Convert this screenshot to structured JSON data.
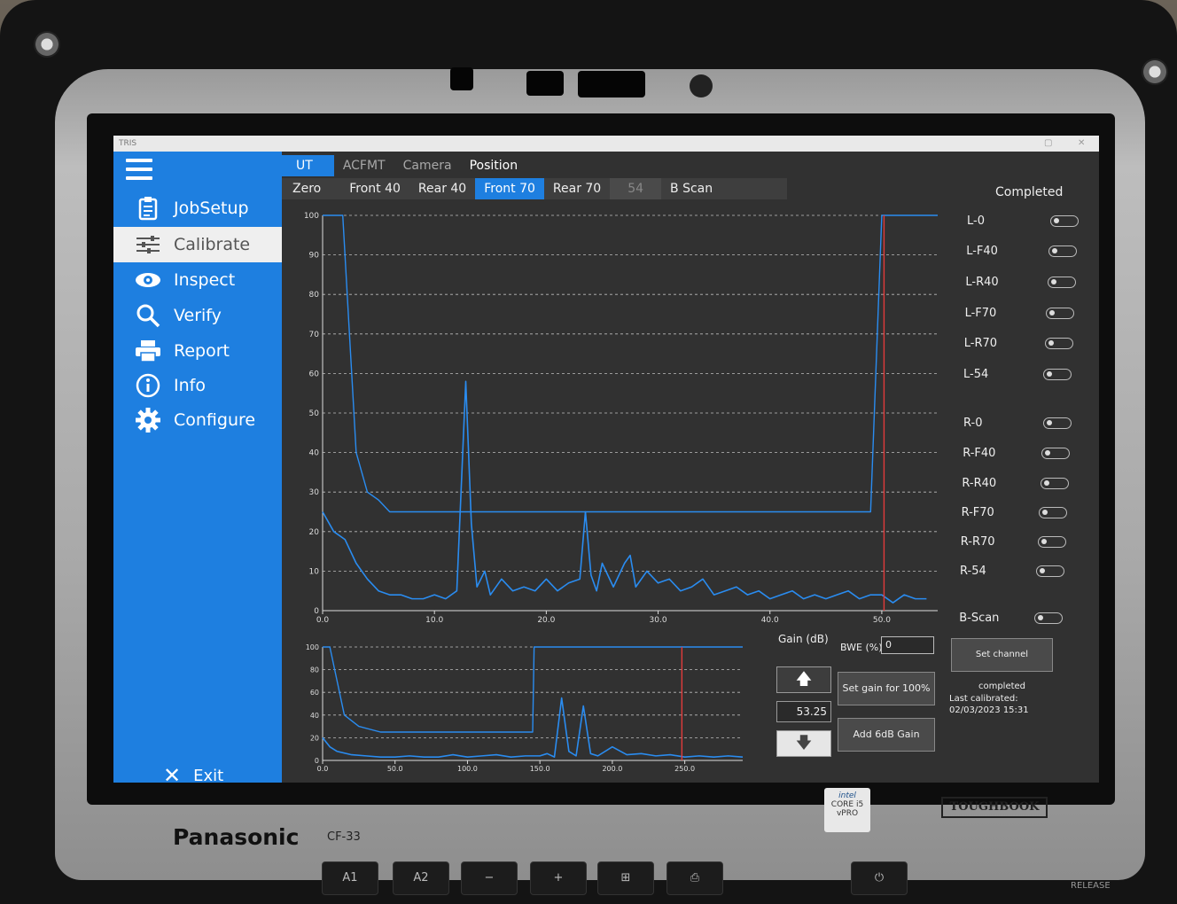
{
  "device": {
    "brand": "Panasonic",
    "model": "CF-33",
    "badge": "TOUGHBOOK",
    "intel_lines": [
      "intel",
      "CORE i5",
      "vPRO"
    ],
    "release": "RELEASE",
    "hw_keys": [
      "A1",
      "A2",
      "−",
      "+",
      "⊞",
      "⎙",
      "⏻"
    ]
  },
  "window": {
    "title": "TRIS"
  },
  "sidebar": {
    "items": [
      {
        "label": "JobSetup",
        "icon": "clipboard-icon"
      },
      {
        "label": "Calibrate",
        "icon": "sliders-icon",
        "active": true
      },
      {
        "label": "Inspect",
        "icon": "eye-icon"
      },
      {
        "label": "Verify",
        "icon": "search-icon"
      },
      {
        "label": "Report",
        "icon": "printer-icon"
      },
      {
        "label": "Info",
        "icon": "info-icon"
      },
      {
        "label": "Configure",
        "icon": "gear-icon"
      }
    ],
    "exit_label": "Exit"
  },
  "top_tabs": [
    "UT",
    "ACFMT",
    "Camera",
    "Position"
  ],
  "sub_tabs": [
    "Zero",
    "Front 40",
    "Rear 40",
    "Front 70",
    "Rear 70",
    "54",
    "B Scan"
  ],
  "colors": {
    "accent": "#1e7fe0",
    "signal": "#2a8cf0",
    "gate": "#e23b3b",
    "panel": "#313131"
  },
  "panel": {
    "header": "Completed",
    "channels": [
      "L-0",
      "L-F40",
      "L-R40",
      "L-F70",
      "L-R70",
      "L-54",
      "R-0",
      "R-F40",
      "R-R40",
      "R-F70",
      "R-R70",
      "R-54",
      "B-Scan"
    ]
  },
  "controls": {
    "gain_label": "Gain (dB)",
    "gain_value": "53.25",
    "bwe_label": "BWE (%)",
    "bwe_value": "0",
    "set_gain_button": "Set gain for 100%",
    "add_gain_button": "Add 6dB Gain",
    "set_channel_button": "Set channel completed",
    "last_calibrated_label": "Last calibrated:",
    "last_calibrated_value": "02/03/2023 15:31"
  },
  "chart_data": [
    {
      "type": "line",
      "title": "",
      "xlabel": "",
      "ylabel": "",
      "xlim": [
        0,
        55
      ],
      "ylim": [
        0,
        100
      ],
      "x_ticks": [
        "0.0",
        "10.0",
        "20.0",
        "30.0",
        "40.0",
        "50.0"
      ],
      "y_ticks": [
        "0",
        "10",
        "20",
        "30",
        "40",
        "50",
        "60",
        "70",
        "80",
        "90",
        "100"
      ],
      "grid": true,
      "series": [
        {
          "role": "a-scan",
          "x": [
            0,
            1,
            2,
            3,
            4,
            5,
            6,
            7,
            8,
            9,
            10,
            11,
            12,
            12.8,
            13.3,
            13.8,
            14.5,
            15,
            16,
            17,
            18,
            19,
            20,
            21,
            22,
            23,
            23.5,
            24,
            24.5,
            25,
            26,
            27,
            27.5,
            28,
            29,
            30,
            31,
            32,
            33,
            34,
            35,
            36,
            37,
            38,
            39,
            40,
            41,
            42,
            43,
            44,
            45,
            46,
            47,
            48,
            49,
            50,
            51,
            52,
            53,
            54
          ],
          "y": [
            25,
            20,
            18,
            12,
            8,
            5,
            4,
            4,
            3,
            3,
            4,
            3,
            5,
            58,
            22,
            6,
            10,
            4,
            8,
            5,
            6,
            5,
            8,
            5,
            7,
            8,
            25,
            9,
            5,
            12,
            6,
            12,
            14,
            6,
            10,
            7,
            8,
            5,
            6,
            8,
            4,
            5,
            6,
            4,
            5,
            3,
            4,
            5,
            3,
            4,
            3,
            4,
            5,
            3,
            4,
            4,
            2,
            4,
            3,
            3
          ]
        },
        {
          "role": "dac-curve",
          "x": [
            0,
            1.8,
            3,
            4,
            5,
            6,
            7,
            8,
            9,
            10,
            20,
            30,
            40,
            49,
            50,
            51,
            55
          ],
          "y": [
            100,
            100,
            40,
            30,
            28,
            25,
            25,
            25,
            25,
            25,
            25,
            25,
            25,
            25,
            100,
            100,
            100
          ]
        },
        {
          "role": "gate-marker",
          "x": [
            50.2,
            50.2
          ],
          "y": [
            0,
            100
          ]
        }
      ]
    },
    {
      "type": "line",
      "title": "",
      "xlim": [
        0,
        290
      ],
      "ylim": [
        0,
        100
      ],
      "x_ticks": [
        "0.0",
        "50.0",
        "100.0",
        "150.0",
        "200.0",
        "250.0"
      ],
      "y_ticks": [
        "0",
        "20",
        "40",
        "60",
        "80",
        "100"
      ],
      "grid": true,
      "series": [
        {
          "role": "a-scan",
          "x": [
            0,
            5,
            10,
            20,
            30,
            40,
            50,
            60,
            70,
            80,
            90,
            100,
            110,
            120,
            130,
            140,
            150,
            155,
            160,
            165,
            170,
            175,
            180,
            185,
            190,
            200,
            210,
            220,
            230,
            240,
            250,
            260,
            270,
            280,
            290
          ],
          "y": [
            20,
            12,
            8,
            5,
            4,
            3,
            3,
            4,
            3,
            3,
            5,
            3,
            4,
            5,
            3,
            4,
            4,
            6,
            3,
            55,
            8,
            4,
            48,
            6,
            4,
            12,
            5,
            6,
            4,
            5,
            3,
            4,
            3,
            4,
            3
          ]
        },
        {
          "role": "dac-curve",
          "x": [
            0,
            5,
            15,
            25,
            40,
            145,
            146,
            300
          ],
          "y": [
            100,
            100,
            40,
            30,
            25,
            25,
            100,
            100
          ]
        },
        {
          "role": "gate-marker",
          "x": [
            248,
            248
          ],
          "y": [
            0,
            100
          ]
        }
      ]
    }
  ]
}
